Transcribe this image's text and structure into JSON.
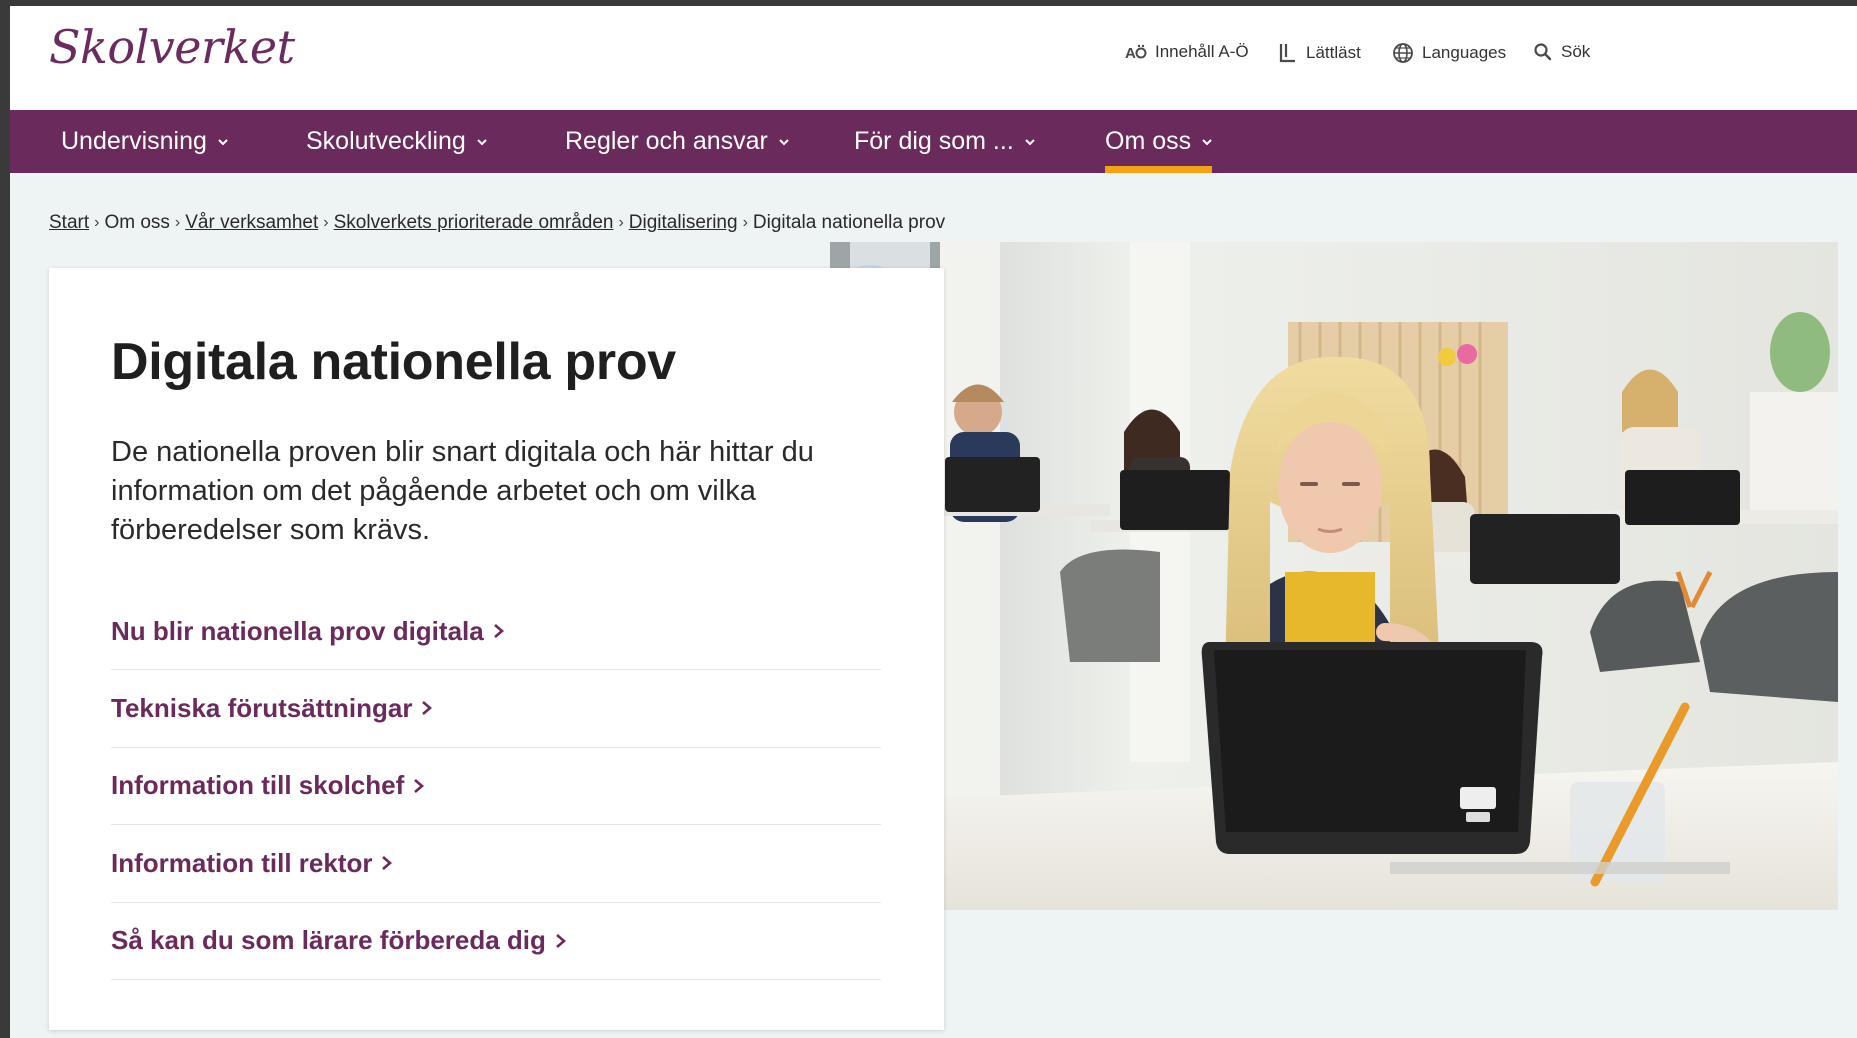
{
  "header": {
    "logo": "Skolverket",
    "utilities": [
      {
        "icon": "text-az-icon",
        "label": "Innehåll A-Ö"
      },
      {
        "icon": "easy-read-icon",
        "label": "Lättläst"
      },
      {
        "icon": "globe-icon",
        "label": "Languages"
      },
      {
        "icon": "search-icon",
        "label": "Sök"
      }
    ]
  },
  "nav": {
    "items": [
      {
        "label": "Undervisning"
      },
      {
        "label": "Skolutveckling"
      },
      {
        "label": "Regler och ansvar"
      },
      {
        "label": "För dig som ..."
      },
      {
        "label": "Om oss",
        "active": true
      }
    ],
    "accent": "#f3a312",
    "background": "#6b2a5c"
  },
  "breadcrumb": {
    "items": [
      "Start",
      "Om oss",
      "Vår verksamhet",
      "Skolverkets prioriterade områden",
      "Digitalisering",
      "Digitala nationella prov"
    ]
  },
  "main": {
    "title": "Digitala nationella prov",
    "lead": "De nationella proven blir snart digitala och här hittar du information om det pågående arbetet och om vilka förberedelser som krävs.",
    "links": [
      "Nu blir nationella prov digitala",
      "Tekniska förutsättningar",
      "Information till skolchef",
      "Information till rektor",
      "Så kan du som lärare förbereda dig"
    ]
  }
}
